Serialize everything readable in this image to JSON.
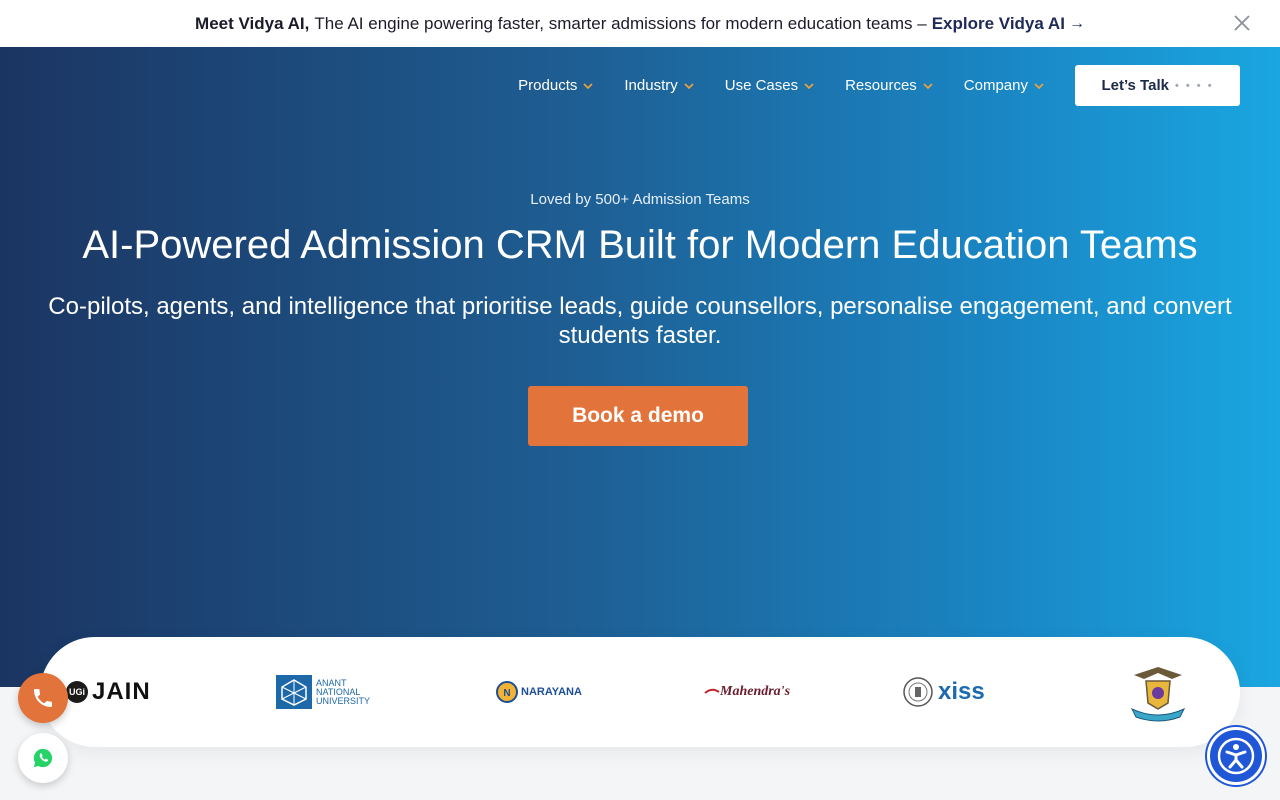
{
  "announcement": {
    "lead": "Meet Vidya AI,",
    "text": "The AI engine powering faster, smarter admissions for modern education teams –",
    "link": "Explore Vidya AI",
    "arrow": "→",
    "close_icon": "close-icon"
  },
  "nav": {
    "items": [
      {
        "label": "Products"
      },
      {
        "label": "Industry"
      },
      {
        "label": "Use Cases"
      },
      {
        "label": "Resources"
      },
      {
        "label": "Company"
      }
    ],
    "cta_label": "Let’s Talk",
    "cta_dots": "• •  • •"
  },
  "hero": {
    "eyebrow": "Loved by 500+ Admission Teams",
    "title": "AI-Powered Admission CRM Built for Modern Education Teams",
    "subtitle": "Co-pilots, agents, and intelligence that prioritise leads, guide counsellors, personalise engagement, and convert students faster.",
    "cta": "Book a demo"
  },
  "logos": {
    "jain": {
      "badge": "UGi",
      "name": "JAIN"
    },
    "anant": {
      "line1": "ANANT",
      "line2": "NATIONAL",
      "line3": "UNIVERSITY"
    },
    "narayana": {
      "name": "NARAYANA"
    },
    "mahendras": {
      "name": "Mahendra's"
    },
    "xiss": {
      "name": "xiss"
    }
  },
  "colors": {
    "accent": "#e2733a",
    "hero_start": "#1b3562",
    "hero_end": "#1aa6e0",
    "accessibility": "#1f57d6",
    "whatsapp": "#25d366"
  },
  "icons": {
    "phone": "phone-icon",
    "whatsapp": "whatsapp-icon",
    "accessibility": "accessibility-icon",
    "chevron": "chevron-down-icon"
  }
}
